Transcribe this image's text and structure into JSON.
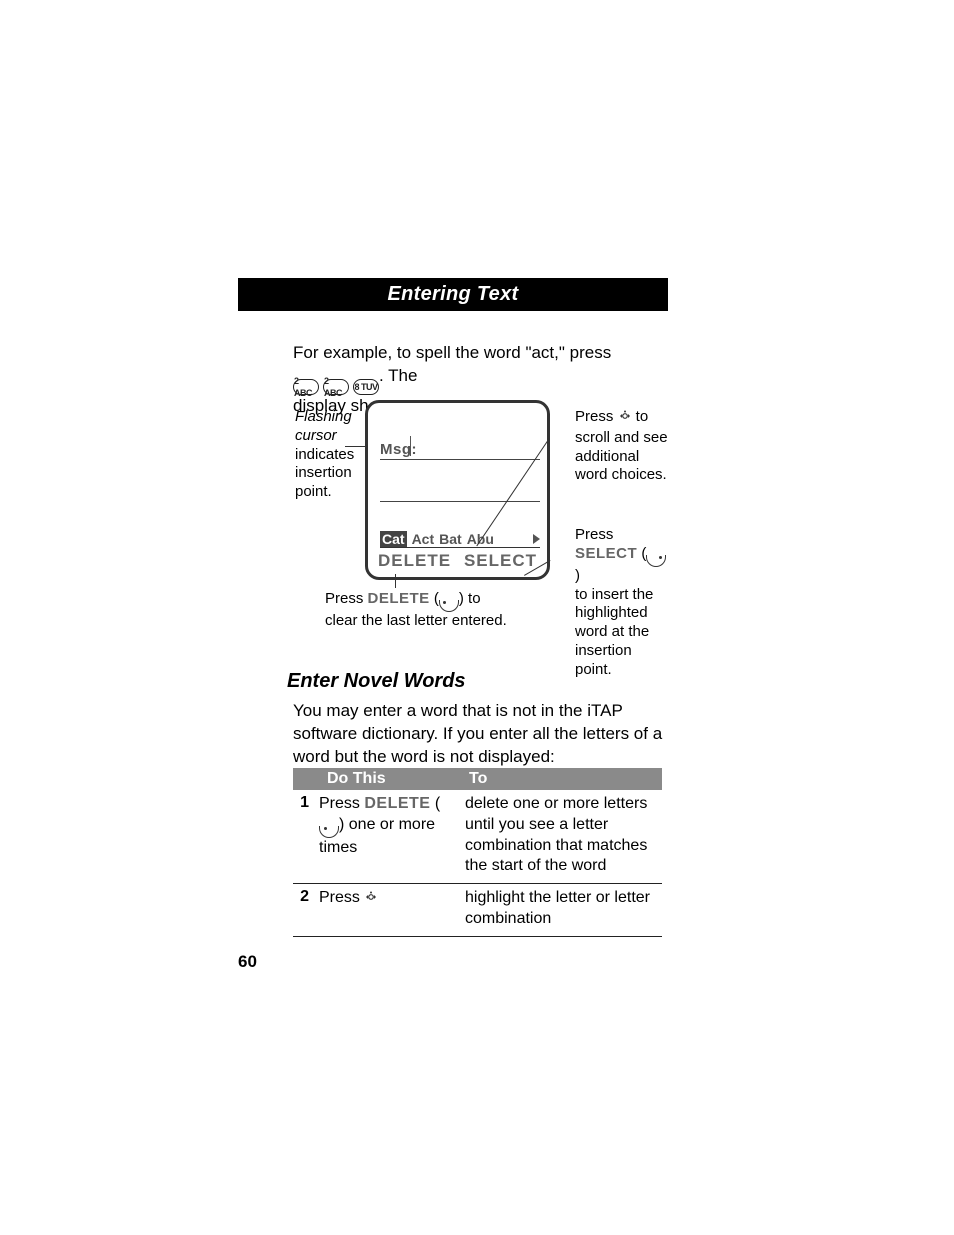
{
  "header": {
    "title": "Entering Text"
  },
  "intro": {
    "line1_a": "For example, to spell the word \"act,\" press ",
    "keys": [
      "2 ABC",
      "2 ABC",
      "8 TUV"
    ],
    "line1_b": ". The",
    "line2": "display shows:"
  },
  "display": {
    "msg_label": "Msg:",
    "candidates": {
      "highlighted": "Cat",
      "others": [
        "Act",
        "Bat",
        "Abu"
      ]
    },
    "softkeys": {
      "left": "DELETE",
      "right": "SELECT"
    }
  },
  "callouts": {
    "left": {
      "l1_it": "Flashing",
      "l2_it": "cursor",
      "l3": "indicates",
      "l4": "insertion",
      "l5": "point."
    },
    "right1": {
      "l1a": "Press ",
      "l1b": " to",
      "l2": "scroll and see",
      "l3": "additional",
      "l4": "word choices."
    },
    "right2": {
      "l1": "Press",
      "l2a": "SELECT",
      "l2b": " (",
      "l2c": ")",
      "l3": "to insert the",
      "l4": "highlighted",
      "l5": "word at the",
      "l6": "insertion point."
    },
    "bottom": {
      "l1a": "Press ",
      "l1b": "DELETE",
      "l1c": " (",
      "l1d": ") to",
      "l2": "clear the last letter entered."
    }
  },
  "section": {
    "title": "Enter Novel Words",
    "p1": "You may enter a word that is not in the iTAP software dictionary. If you enter all the letters of a word but the word is not displayed:"
  },
  "table": {
    "head": {
      "c1": "Do This",
      "c2": "To"
    },
    "rows": [
      {
        "n": "1",
        "do_a": "Press ",
        "do_b": "DELETE",
        "do_c": " (",
        "do_d": ") one or more times",
        "to": "delete one or more letters until you see a letter combination that matches the start of the word"
      },
      {
        "n": "2",
        "do_a": "Press ",
        "do_b": "",
        "do_c": "",
        "do_d": "",
        "to": "highlight the letter or letter combination"
      }
    ]
  },
  "page_number": "60"
}
